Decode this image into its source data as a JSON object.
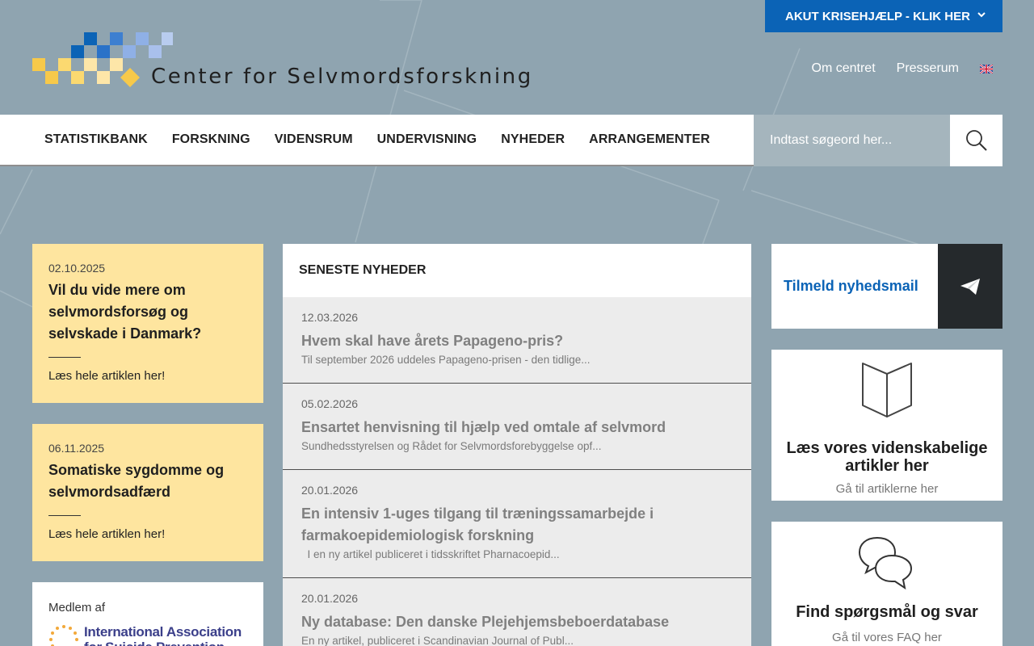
{
  "header": {
    "crisis_button": "AKUT KRISEHJÆLP - KLIK HER",
    "logo_text": "Center for Selvmordsforskning",
    "top_links": [
      "Om centret",
      "Presserum"
    ],
    "language_flag": "uk-flag-icon"
  },
  "nav": {
    "items": [
      "STATISTIKBANK",
      "FORSKNING",
      "VIDENSRUM",
      "UNDERVISNING",
      "NYHEDER",
      "ARRANGEMENTER"
    ],
    "search_placeholder": "Indtast søgeord her..."
  },
  "features": [
    {
      "date": "02.10.2025",
      "title": "Vil du vide mere om selvmordsforsøg og selvskade i Danmark?",
      "more": "Læs hele artiklen her!"
    },
    {
      "date": "06.11.2025",
      "title": "Somatiske sygdomme og selvmordsadfærd",
      "more": "Læs hele artiklen her!"
    }
  ],
  "member": {
    "label": "Medlem af",
    "org_line1": "International Association",
    "org_line2": "for Suicide Prevention"
  },
  "news": {
    "header": "SENESTE NYHEDER",
    "items": [
      {
        "date": "12.03.2026",
        "title": "Hvem skal have årets Papageno-pris?",
        "excerpt": "Til september 2026 uddeles Papageno-prisen - den tidlige..."
      },
      {
        "date": "05.02.2026",
        "title": "Ensartet henvisning til hjælp ved omtale af selvmord",
        "excerpt": "Sundhedsstyrelsen og Rådet for Selvmordsforebyggelse opf..."
      },
      {
        "date": "20.01.2026",
        "title": "En intensiv 1-uges tilgang til træningssamarbejde i farmakoepidemiologisk forskning",
        "excerpt": "  I en ny artikel publiceret i tidsskriftet Pharnacoepid..."
      },
      {
        "date": "20.01.2026",
        "title": "Ny database: Den danske Plejehjemsbeboerdatabase",
        "excerpt": "En ny artikel, publiceret i Scandinavian Journal of Publ..."
      }
    ]
  },
  "sidebar": {
    "newsletter": "Tilmeld nyhedsmail",
    "articles_title": "Læs vores videnskabelige artikler her",
    "articles_sub": "Gå til artiklerne her",
    "faq_title": "Find spørgsmål og svar",
    "faq_sub": "Gå til vores FAQ her"
  },
  "colors": {
    "background": "#8fa4b0",
    "accent_blue": "#0b63b6",
    "feature_yellow": "#fee59f",
    "dark": "#25292c"
  }
}
